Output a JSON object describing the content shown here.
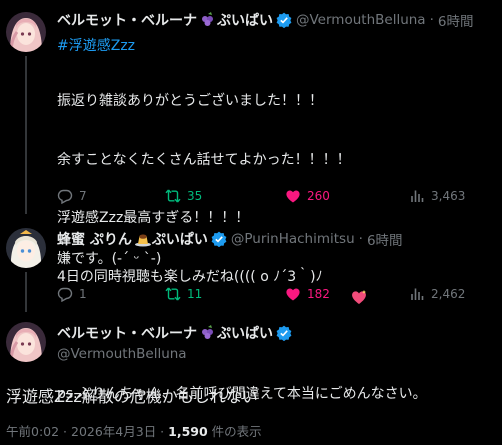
{
  "tweets": [
    {
      "display_name": "ベルモット・ベルーナ",
      "name_suffix": "ぷいぱい",
      "handle": "@VermouthBelluna",
      "time": "6時間",
      "hashtag": "#浮遊感Zzz",
      "lines": [
        "振返り雑談ありがとうございました！！！",
        "余すことなくたくさん話せてよかった！！！！",
        "浮遊感Zzz最高すぎる！！！！",
        "4日の同時視聴も楽しみだね(((( o ﾉ´3｀)ﾉ",
        "",
        "ps.ぷりんちゃん、名前呼び間違えて本当にごめんなさい。"
      ],
      "replies": "7",
      "retweets": "35",
      "likes": "260",
      "views": "3,463"
    },
    {
      "display_name": "蜂蜜 ぷりん",
      "name_suffix": "ぷいぱい",
      "handle": "@PurinHachimitsu",
      "time": "6時間",
      "text": "嫌です。(-´ ᵕ `-)",
      "replies": "1",
      "retweets": "11",
      "likes": "182",
      "views": "2,462"
    }
  ],
  "main": {
    "display_name": "ベルモット・ベルーナ",
    "name_suffix": "ぷいぱい",
    "handle": "@VermouthBelluna",
    "text": "浮遊感Zzz解散の危機かもしれない",
    "timestamp": "午前0:02 · 2026年4月3日 · ",
    "views_count": "1,590",
    "views_label": " 件の表示"
  },
  "colors": {
    "accent": "#1d9bf0",
    "retweet": "#00ba7c",
    "like": "#f91880",
    "muted": "#71767b"
  }
}
